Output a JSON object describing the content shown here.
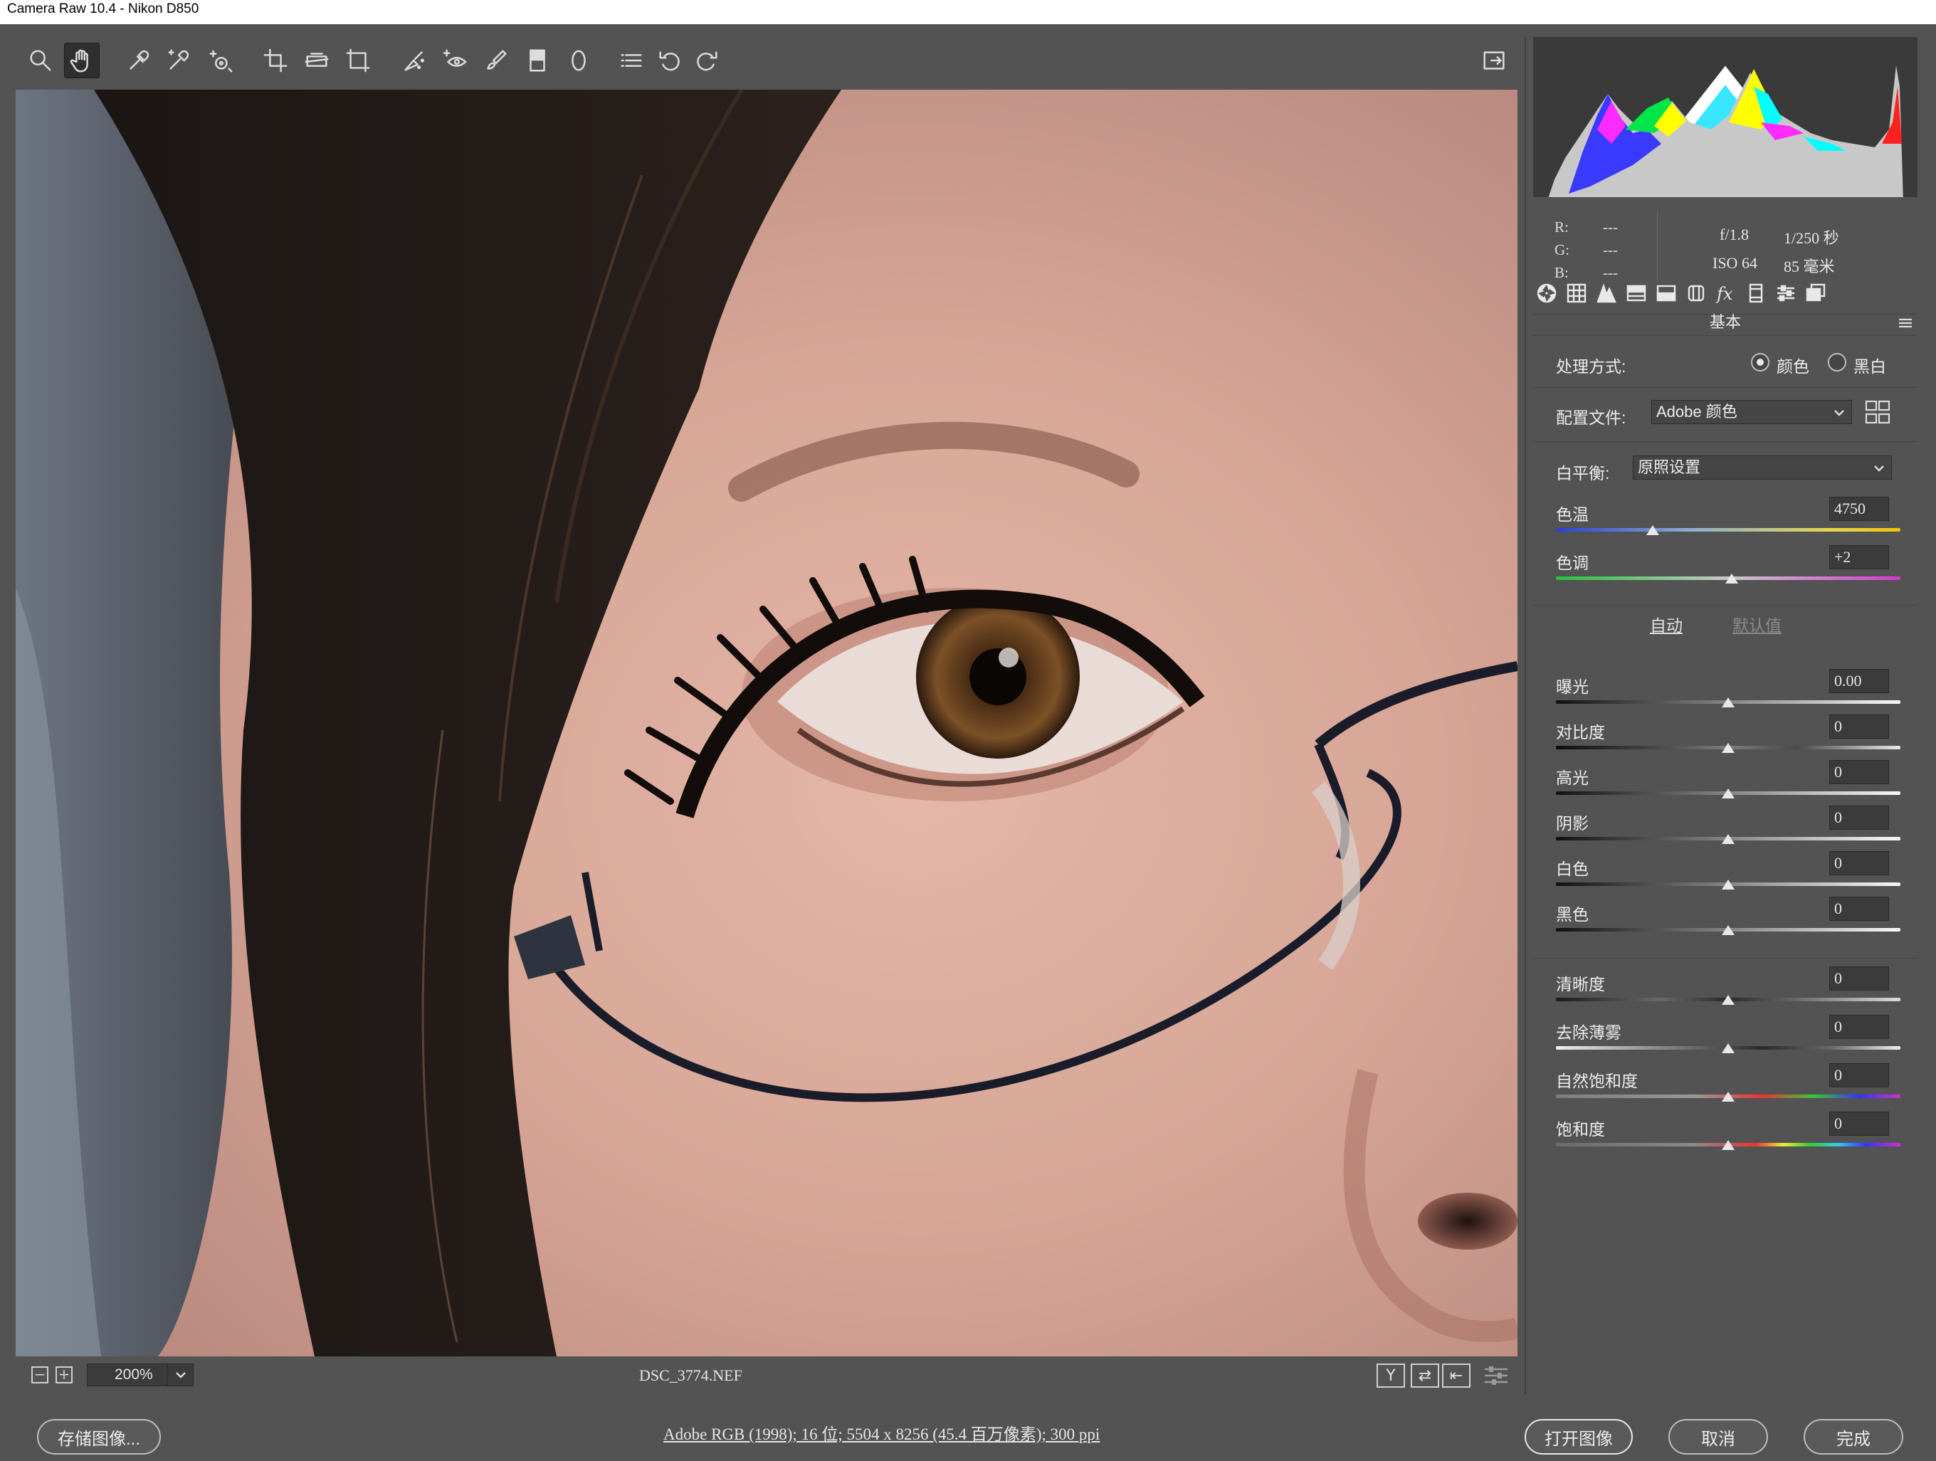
{
  "window": {
    "title": "Camera Raw 10.4 -  Nikon D850"
  },
  "toolbar": {
    "tools": [
      "zoom-tool",
      "hand-tool",
      "white-balance-tool",
      "color-sampler-tool",
      "targeted-adjustment-tool",
      "crop-tool",
      "straighten-tool",
      "transform-tool",
      "spot-removal-tool",
      "red-eye-tool",
      "adjustment-brush-tool",
      "graduated-filter-tool",
      "radial-filter-tool",
      "open-preferences",
      "rotate-ccw-tool",
      "rotate-cw-tool"
    ],
    "active_tool": "hand-tool",
    "fullscreen_icon": "toggle-fullscreen-icon"
  },
  "status": {
    "zoom": "200%",
    "filename": "DSC_3774.NEF",
    "view_y": "Y",
    "view_swap": "⇄",
    "view_copy": "⇤"
  },
  "info": {
    "r_label": "R:",
    "g_label": "G:",
    "b_label": "B:",
    "r_value": "---",
    "g_value": "---",
    "b_value": "---",
    "aperture": "f/1.8",
    "shutter": "1/250 秒",
    "iso": "ISO 64",
    "focal": "85 毫米"
  },
  "panel": {
    "section_title": "基本",
    "treatment_label": "处理方式:",
    "treatment_color": "颜色",
    "treatment_bw": "黑白",
    "treatment_selected": "颜色",
    "profile_label": "配置文件:",
    "profile_value": "Adobe 颜色",
    "wb_label": "白平衡:",
    "wb_value": "原照设置",
    "auto_label": "自动",
    "default_label": "默认值",
    "sliders": [
      {
        "name": "色温",
        "value": "4750",
        "pos": 0.28
      },
      {
        "name": "色调",
        "value": "+2",
        "pos": 0.51
      },
      {
        "name": "曝光",
        "value": "0.00",
        "pos": 0.5
      },
      {
        "name": "对比度",
        "value": "0",
        "pos": 0.5
      },
      {
        "name": "高光",
        "value": "0",
        "pos": 0.5
      },
      {
        "name": "阴影",
        "value": "0",
        "pos": 0.5
      },
      {
        "name": "白色",
        "value": "0",
        "pos": 0.5
      },
      {
        "name": "黑色",
        "value": "0",
        "pos": 0.5
      },
      {
        "name": "清晰度",
        "value": "0",
        "pos": 0.5
      },
      {
        "name": "去除薄雾",
        "value": "0",
        "pos": 0.5
      },
      {
        "name": "自然饱和度",
        "value": "0",
        "pos": 0.5
      },
      {
        "name": "饱和度",
        "value": "0",
        "pos": 0.5
      }
    ]
  },
  "bottom": {
    "save_label": "存储图像...",
    "workflow_info": "Adobe RGB (1998); 16 位; 5504 x 8256 (45.4 百万像素); 300 ppi",
    "open_label": "打开图像",
    "cancel_label": "取消",
    "done_label": "完成"
  }
}
